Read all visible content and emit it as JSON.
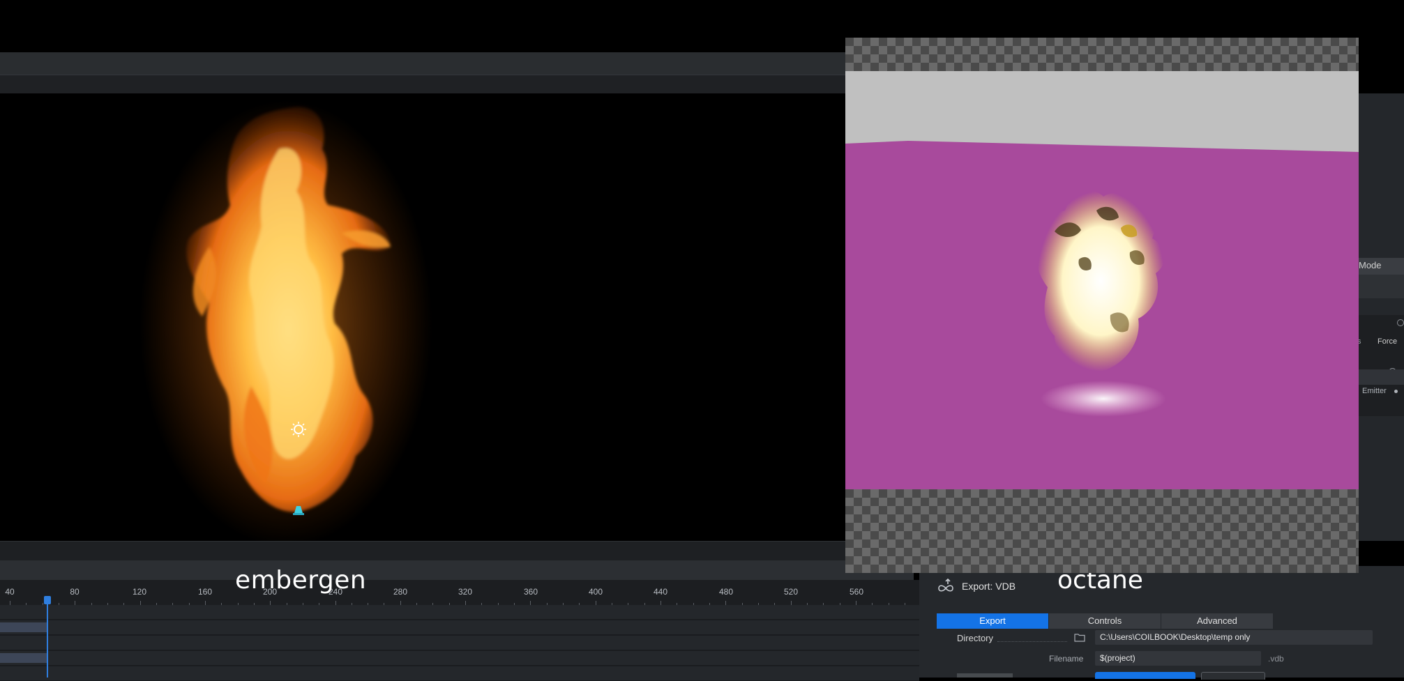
{
  "captions": {
    "left": "embergen",
    "right": "octane"
  },
  "timeline": {
    "ticks": [
      "40",
      "80",
      "120",
      "160",
      "200",
      "240",
      "280",
      "320",
      "360",
      "400",
      "440",
      "480",
      "520",
      "560"
    ],
    "playhead_frame": 70
  },
  "right_panel": {
    "mode_label": "Mode",
    "tab_partial": "s",
    "force_label": "Force",
    "volume_label": "olume",
    "emitter_label": "Emitter"
  },
  "export_panel": {
    "title": "Export: VDB",
    "tabs": [
      "Export",
      "Controls",
      "Advanced"
    ],
    "active_tab": "Export",
    "directory_label": "Directory",
    "directory_value": "C:\\Users\\COILBOOK\\Desktop\\temp only",
    "filename_label": "Filename",
    "filename_value": "$(project)",
    "filename_ext": ".vdb"
  },
  "colors": {
    "accent": "#1473e6",
    "octane_backdrop": "#a84a9c",
    "octane_floor": "#c0c0c0",
    "fire_core": "#ffcf5a",
    "fire_edge": "#e0500c"
  },
  "icons": {
    "sun": "sun-light-icon",
    "emitter": "emitter-icon",
    "export": "export-vdb-icon",
    "folder": "folder-icon",
    "power": "power-icon"
  }
}
